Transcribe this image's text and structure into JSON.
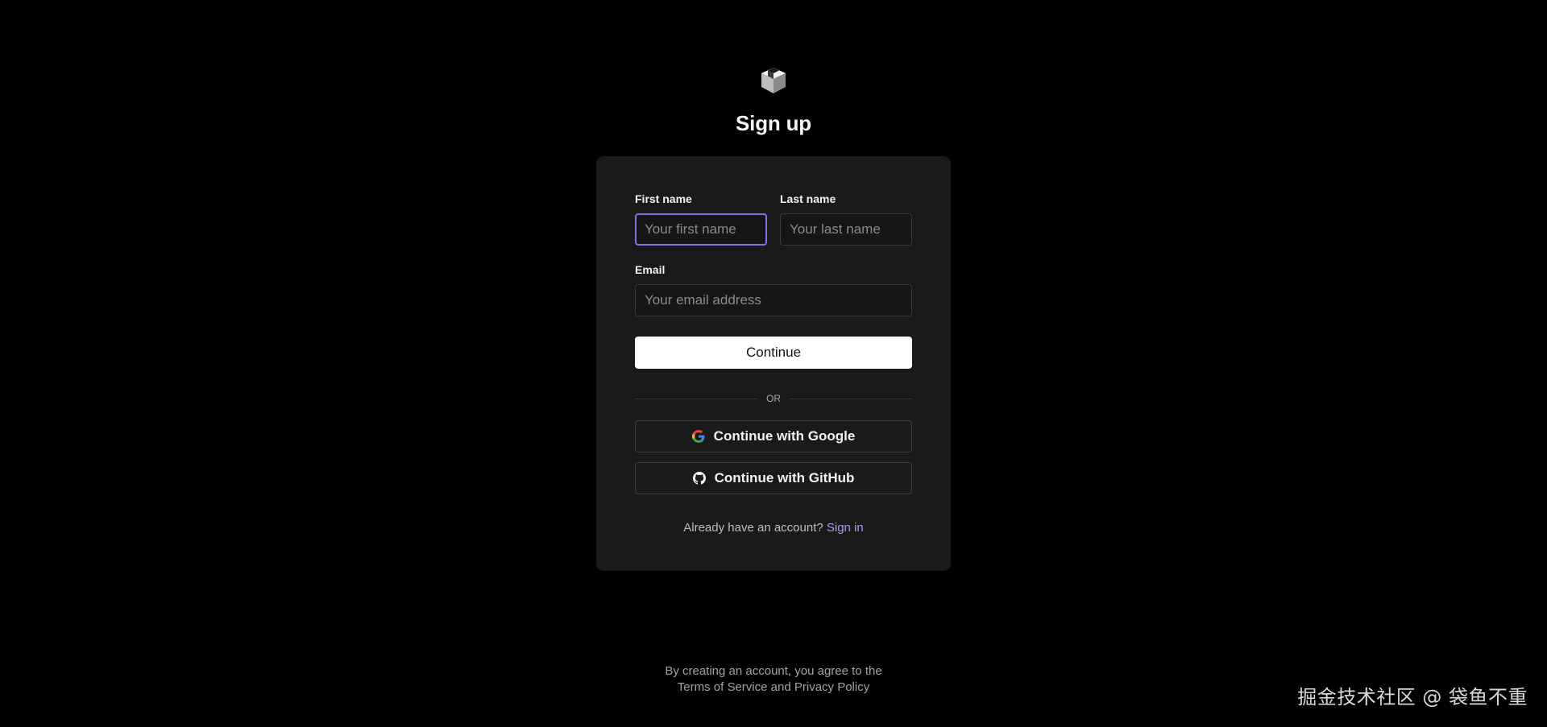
{
  "brand": {
    "logo_icon": "cube-logo-icon"
  },
  "heading": "Sign up",
  "form": {
    "first_name_label": "First name",
    "first_name_placeholder": "Your first name",
    "first_name_value": "",
    "last_name_label": "Last name",
    "last_name_placeholder": "Your last name",
    "last_name_value": "",
    "email_label": "Email",
    "email_placeholder": "Your email address",
    "email_value": "",
    "continue_label": "Continue",
    "or_label": "OR"
  },
  "oauth": {
    "google_label": "Continue with Google",
    "google_icon": "google-icon",
    "github_label": "Continue with GitHub",
    "github_icon": "github-icon"
  },
  "signin": {
    "prompt": "Already have an account?",
    "link_label": "Sign in"
  },
  "footer": {
    "line1": "By creating an account, you agree to the",
    "terms_label": "Terms of Service",
    "and_label": "and",
    "privacy_label": "Privacy Policy"
  },
  "watermark": "掘金技术社区 @ 袋鱼不重",
  "colors": {
    "background": "#000000",
    "card": "#1a1a1a",
    "focus_border": "#7b74e8",
    "link": "#a59cf2",
    "primary_button": "#ffffff"
  }
}
